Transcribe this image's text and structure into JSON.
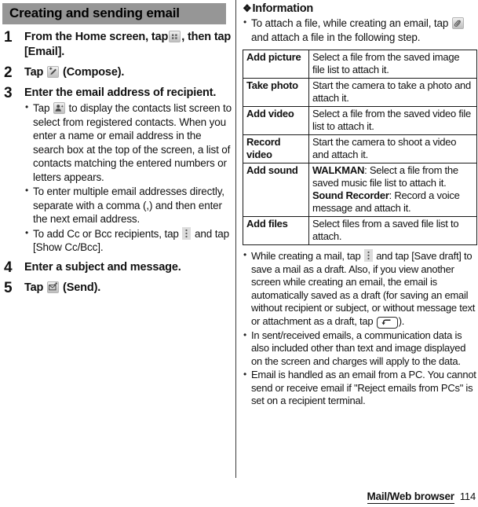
{
  "left": {
    "section_title": "Creating and sending email",
    "steps": [
      {
        "num": "1",
        "title_a": "From the Home screen, tap",
        "icon": "app-drawer-icon",
        "title_b": ", then tap [Email].",
        "bullets": []
      },
      {
        "num": "2",
        "title_a": "Tap",
        "icon": "compose-icon",
        "title_b": "(Compose).",
        "bullets": []
      },
      {
        "num": "3",
        "title_a": "Enter the email address of recipient.",
        "bullets": [
          {
            "pre": "Tap",
            "icon": "contacts-icon",
            "post": "to display the contacts list screen to select from registered contacts. When you enter a name or email address in the search box at the top of the screen, a list of contacts matching the entered numbers or letters appears."
          },
          {
            "pre": "To enter multiple email addresses directly, separate with a comma (,) and then enter the next email address.",
            "icon": "",
            "post": ""
          },
          {
            "pre": "To add Cc or Bcc recipients, tap",
            "icon": "kebab-menu-icon",
            "post": "and tap [Show Cc/Bcc]."
          }
        ]
      },
      {
        "num": "4",
        "title_a": "Enter a subject and message.",
        "bullets": []
      },
      {
        "num": "5",
        "title_a": "Tap",
        "icon": "send-icon",
        "title_b": "(Send).",
        "bullets": []
      }
    ]
  },
  "right": {
    "info_heading": "Information",
    "info_diamond": "❖",
    "intro": {
      "pre": "To attach a file, while creating an email, tap",
      "icon": "attach-paperclip-icon",
      "post": "and attach a file in the following step."
    },
    "table": {
      "rows": [
        {
          "key": "Add picture",
          "value": "Select a file from the saved image file list to attach it."
        },
        {
          "key": "Take photo",
          "value": "Start the camera to take a photo and attach it."
        },
        {
          "key": "Add video",
          "value": "Select a file from the saved video file list to attach it."
        },
        {
          "key": "Record video",
          "value": "Start the camera to shoot a video and attach it."
        },
        {
          "key": "Add sound",
          "value_bold_1": "WALKMAN",
          "value_rest_1": ": Select a file from the saved music file list to attach it.",
          "value_bold_2": "Sound Recorder",
          "value_rest_2": ": Record a voice message and attach it."
        },
        {
          "key": "Add files",
          "value": "Select files from a saved file list to attach."
        }
      ]
    },
    "notes": [
      {
        "pre": "While creating a mail, tap",
        "icon1": "kebab-menu-icon",
        "mid": "and tap [Save draft] to save a mail as a draft. Also, if you view another screen while creating an email, the email is automatically saved as a draft (for saving an email without recipient or subject, or without message text or attachment as a draft, tap",
        "icon2": "back-key-icon",
        "post": ")."
      },
      {
        "pre": "In sent/received emails, a communication data is also included other than text and image displayed on the screen and charges will apply to the data.",
        "icon1": "",
        "mid": "",
        "icon2": "",
        "post": ""
      },
      {
        "pre": "Email is handled as an email from a PC. You cannot send or receive email if \"Reject emails from PCs\" is set on a recipient terminal.",
        "icon1": "",
        "mid": "",
        "icon2": "",
        "post": ""
      }
    ]
  },
  "footer": {
    "chapter": "Mail/Web browser",
    "page": "114"
  }
}
